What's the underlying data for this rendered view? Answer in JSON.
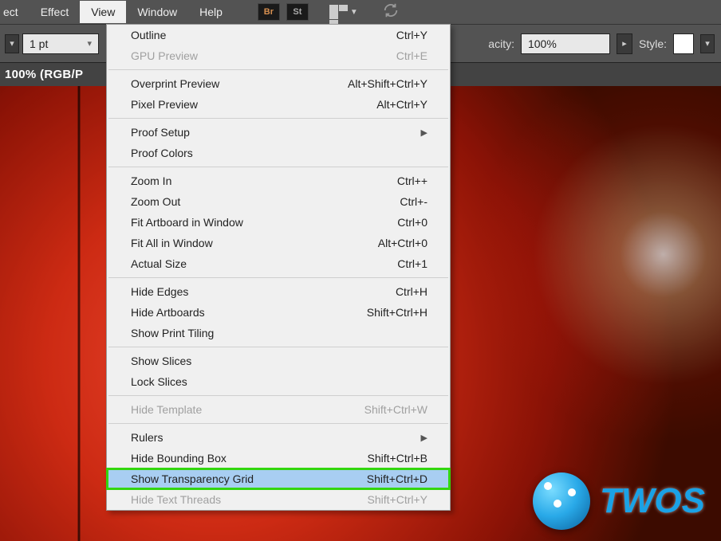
{
  "menubar": {
    "items": [
      {
        "label": "ect",
        "full": "Effect"
      },
      {
        "label": "Effect"
      },
      {
        "label": "View"
      },
      {
        "label": "Window"
      },
      {
        "label": "Help"
      }
    ],
    "br_label": "Br",
    "st_label": "St"
  },
  "optionsbar": {
    "stroke_value": "1 pt",
    "opacity_label": "acity:",
    "opacity_value": "100%",
    "style_label": "Style:"
  },
  "doctab": {
    "title": "100% (RGB/P"
  },
  "view_menu": {
    "items": [
      {
        "label": "Outline",
        "shortcut": "Ctrl+Y"
      },
      {
        "label": "GPU Preview",
        "shortcut": "Ctrl+E",
        "disabled": true
      },
      {
        "sep": true
      },
      {
        "label": "Overprint Preview",
        "shortcut": "Alt+Shift+Ctrl+Y"
      },
      {
        "label": "Pixel Preview",
        "shortcut": "Alt+Ctrl+Y"
      },
      {
        "sep": true
      },
      {
        "label": "Proof Setup",
        "submenu": true
      },
      {
        "label": "Proof Colors"
      },
      {
        "sep": true
      },
      {
        "label": "Zoom In",
        "shortcut": "Ctrl++"
      },
      {
        "label": "Zoom Out",
        "shortcut": "Ctrl+-"
      },
      {
        "label": "Fit Artboard in Window",
        "shortcut": "Ctrl+0"
      },
      {
        "label": "Fit All in Window",
        "shortcut": "Alt+Ctrl+0"
      },
      {
        "label": "Actual Size",
        "shortcut": "Ctrl+1"
      },
      {
        "sep": true
      },
      {
        "label": "Hide Edges",
        "shortcut": "Ctrl+H"
      },
      {
        "label": "Hide Artboards",
        "shortcut": "Shift+Ctrl+H"
      },
      {
        "label": "Show Print Tiling"
      },
      {
        "sep": true
      },
      {
        "label": "Show Slices"
      },
      {
        "label": "Lock Slices"
      },
      {
        "sep": true
      },
      {
        "label": "Hide Template",
        "shortcut": "Shift+Ctrl+W",
        "disabled": true
      },
      {
        "sep": true
      },
      {
        "label": "Rulers",
        "submenu": true
      },
      {
        "label": "Hide Bounding Box",
        "shortcut": "Shift+Ctrl+B"
      },
      {
        "label": "Show Transparency Grid",
        "shortcut": "Shift+Ctrl+D",
        "highlight": true
      },
      {
        "label": "Hide Text Threads",
        "shortcut": "Shift+Ctrl+Y",
        "disabled": true
      }
    ]
  },
  "watermark": {
    "text": "TWOS"
  }
}
